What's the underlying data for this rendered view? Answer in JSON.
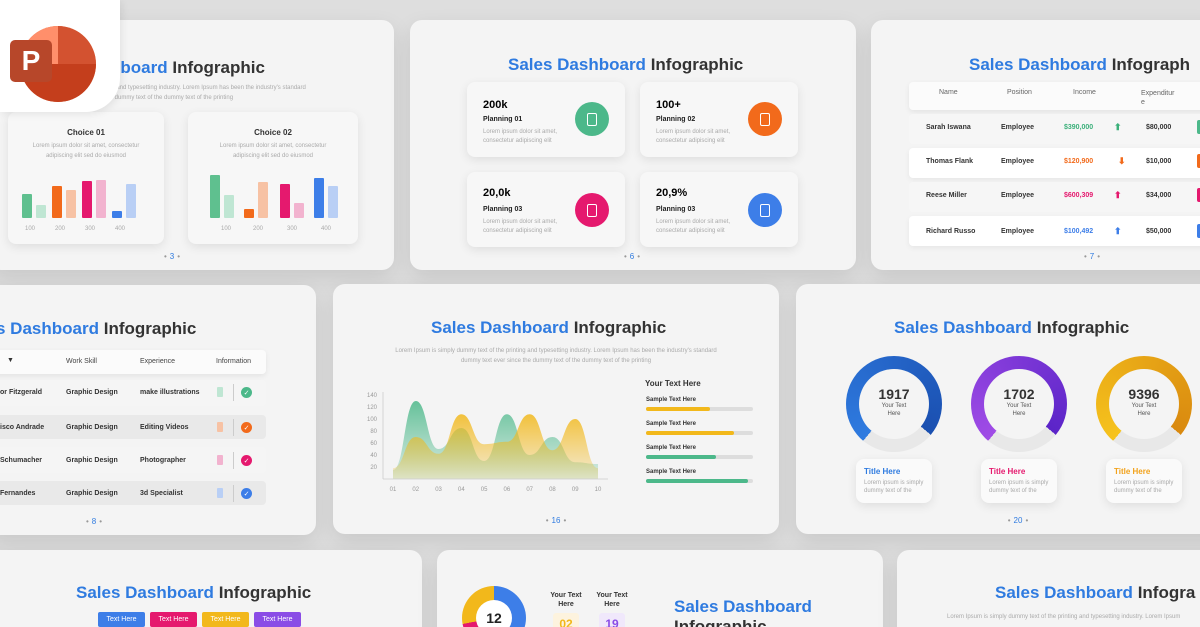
{
  "app_icon": {
    "letter": "P",
    "name": "powerpoint-icon"
  },
  "common": {
    "title_blue": "Sales Dashboard",
    "title_dark": "Infographic",
    "lorem_1": "Lorem Ipsum is simply dummy text of the printing and typesetting industry. Lorem Ipsum has been the industry's standard",
    "lorem_2": "dummy text ever since the dummy text of the dummy text of the printing"
  },
  "card1": {
    "title_blue": "hboard",
    "lorem_1": "e printing and typesetting industry. Lorem Ipsum has been the industry's standard",
    "lorem_2": "text ever dummy text of the dummy text of the printing",
    "panels": [
      {
        "title": "Choice 01",
        "desc1": "Lorem ipsum dolor sit amet, consectetur",
        "desc2": "adipiscing elit sed do eiusmod"
      },
      {
        "title": "Choice 02",
        "desc1": "Lorem ipsum dolor sit amet, consectetur",
        "desc2": "adipiscing elit sed do eiusmod"
      }
    ],
    "axis": [
      "100",
      "200",
      "300",
      "400"
    ],
    "page": "3"
  },
  "card2": {
    "page": "6",
    "items": [
      {
        "stat": "200k",
        "label": "Planning 01",
        "color": "#4cb88a"
      },
      {
        "stat": "100+",
        "label": "Planning 02",
        "color": "#f26a1b"
      },
      {
        "stat": "20,0k",
        "label": "Planning 03",
        "color": "#e5196e"
      },
      {
        "stat": "20,9%",
        "label": "Planning 03",
        "color": "#3d7ee8"
      }
    ],
    "desc1": "Lorem ipsum dolor sit amet,",
    "desc2": "consectetur adipiscing elit"
  },
  "card3": {
    "title_dark": "Infograph",
    "page": "7",
    "headers": [
      "Name",
      "Position",
      "Income",
      "Expenditur"
    ],
    "headers_wrap": "e",
    "rows": [
      {
        "name": "Sarah Iswana",
        "pos": "Employee",
        "income": "$390,000",
        "arrow": "up",
        "color": "#3bb07a",
        "exp": "$80,000"
      },
      {
        "name": "Thomas Flank",
        "pos": "Employee",
        "income": "$120,900",
        "arrow": "down",
        "color": "#f26a1b",
        "exp": "$10,000"
      },
      {
        "name": "Reese Miller",
        "pos": "Employee",
        "income": "$600,309",
        "arrow": "up",
        "color": "#e5196e",
        "exp": "$34,000"
      },
      {
        "name": "Richard Russo",
        "pos": "Employee",
        "income": "$100,492",
        "arrow": "up",
        "color": "#3d7ee8",
        "exp": "$50,000"
      }
    ]
  },
  "card4": {
    "title_blue": "s Dashboard",
    "page": "8",
    "headers": [
      "Work Skill",
      "Experience",
      "Information"
    ],
    "rows": [
      {
        "name": "or Fitzgerald",
        "skill": "Graphic Design",
        "exp": "make illustrations",
        "color": "#4cb88a"
      },
      {
        "name": "isco Andrade",
        "skill": "Graphic Design",
        "exp": "Editing Videos",
        "color": "#f26a1b"
      },
      {
        "name": "Schumacher",
        "skill": "Graphic Design",
        "exp": "Photographer",
        "color": "#e5196e"
      },
      {
        "name": "Fernandes",
        "skill": "Graphic Design",
        "exp": "3d Specialist",
        "color": "#3d7ee8"
      }
    ]
  },
  "card5": {
    "page": "16",
    "heading": "Your Text Here",
    "bars": [
      {
        "label": "Sample Text Here",
        "value": 0.6,
        "color": "#f2b81b"
      },
      {
        "label": "Sample Text Here",
        "value": 0.82,
        "color": "#f2b81b"
      },
      {
        "label": "Sample Text Here",
        "value": 0.65,
        "color": "#4cb88a"
      },
      {
        "label": "Sample Text Here",
        "value": 0.95,
        "color": "#4cb88a"
      }
    ],
    "chart_data": {
      "type": "area",
      "x": [
        "01",
        "02",
        "03",
        "04",
        "05",
        "06",
        "07",
        "08",
        "09",
        "10"
      ],
      "yticks": [
        "140",
        "120",
        "100",
        "80",
        "60",
        "40",
        "20"
      ],
      "ylim": [
        0,
        145
      ],
      "series": [
        {
          "color": "#4cb88a",
          "values": [
            15,
            130,
            50,
            85,
            30,
            108,
            40,
            70,
            28,
            25
          ]
        },
        {
          "color": "#f2b81b",
          "values": [
            18,
            70,
            42,
            108,
            58,
            62,
            108,
            48,
            100,
            18
          ]
        }
      ]
    }
  },
  "card6": {
    "page": "20",
    "donuts": [
      {
        "value": "1917",
        "label1": "Your Text",
        "label2": "Here",
        "pct": 0.75,
        "c1": "#2f7be0",
        "c2": "#1a4fb0",
        "title": "Title Here",
        "tcolor": "#2f7be0"
      },
      {
        "value": "1702",
        "label1": "Your Text",
        "label2": "Here",
        "pct": 0.75,
        "c1": "#a04ce6",
        "c2": "#5b24c8",
        "title": "Title Here",
        "tcolor": "#e5196e"
      },
      {
        "value": "9396",
        "label1": "Your Text",
        "label2": "Here",
        "pct": 0.75,
        "c1": "#f6c31d",
        "c2": "#d9890f",
        "title": "Title Here",
        "tcolor": "#f2a21b"
      }
    ],
    "desc1": "Lorem ipsum is simply",
    "desc2": "dummy text of the"
  },
  "card7": {
    "tags": [
      {
        "label": "Text Here",
        "color": "#3d7ee8"
      },
      {
        "label": "Text Here",
        "color": "#e5196e"
      },
      {
        "label": "Text Here",
        "color": "#f2b81b"
      },
      {
        "label": "Text Here",
        "color": "#8a4ce6"
      }
    ]
  },
  "card8": {
    "donut_value": "12",
    "col1_l1": "Your Text",
    "col1_l2": "Here",
    "col1_val": "02",
    "col2_l1": "Your Text",
    "col2_l2": "Here",
    "col2_val": "19",
    "title1": "Sales Dashboard",
    "title2": "Infographic"
  },
  "card9": {
    "title_dark": "Infogra",
    "lorem": "Lorem Ipsum is simply dummy text of the printing and typesetting industry. Lorem Ipsum"
  }
}
